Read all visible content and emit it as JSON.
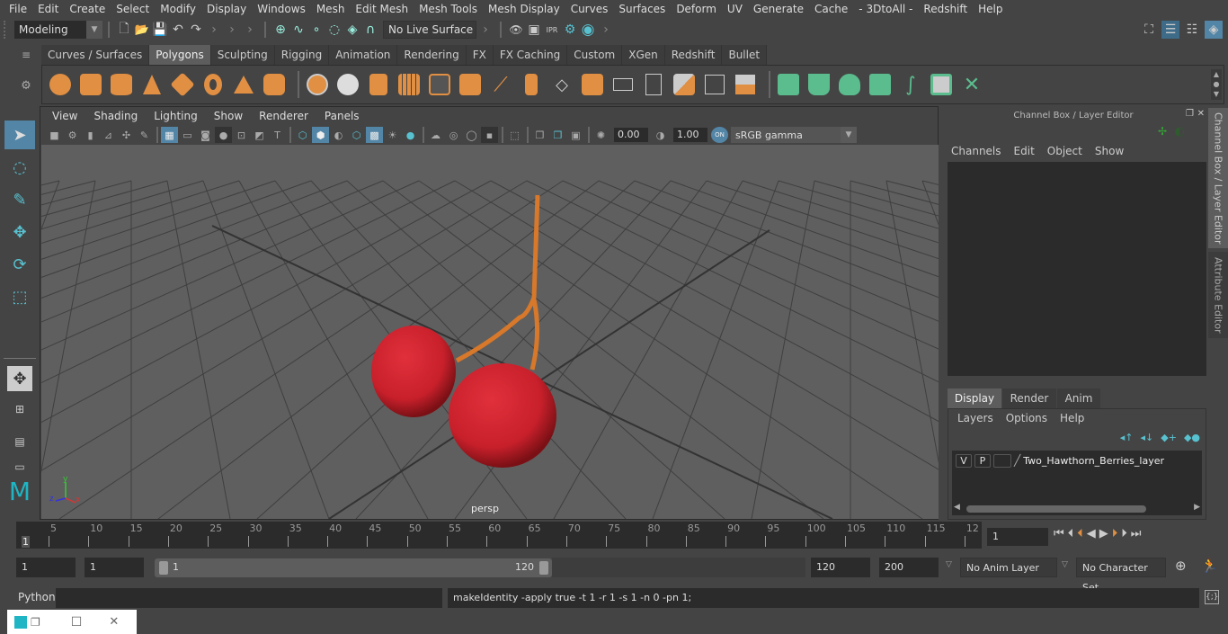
{
  "menubar": [
    "File",
    "Edit",
    "Create",
    "Select",
    "Modify",
    "Display",
    "Windows",
    "Mesh",
    "Edit Mesh",
    "Mesh Tools",
    "Mesh Display",
    "Curves",
    "Surfaces",
    "Deform",
    "UV",
    "Generate",
    "Cache",
    "- 3DtoAll -",
    "Redshift",
    "Help"
  ],
  "statusline": {
    "mode": "Modeling",
    "live_surface": "No Live Surface",
    "icons": [
      "new-scene-icon",
      "open-scene-icon",
      "save-scene-icon",
      "undo-icon",
      "redo-icon"
    ],
    "snap_icons": [
      "snap-grid-icon",
      "snap-curve-icon",
      "snap-point-icon",
      "snap-view-plane-icon",
      "snap-live-icon",
      "snap-magnet-icon"
    ],
    "render_icons": [
      "render-view-icon",
      "render-current-icon",
      "ipr-render-icon",
      "render-settings-icon",
      "hypershade-icon"
    ]
  },
  "shelf": {
    "tabs": [
      "Curves / Surfaces",
      "Polygons",
      "Sculpting",
      "Rigging",
      "Animation",
      "Rendering",
      "FX",
      "FX Caching",
      "Custom",
      "XGen",
      "Redshift",
      "Bullet"
    ],
    "active_tab": "Polygons",
    "poly_icons": [
      "poly-sphere-icon",
      "poly-cube-icon",
      "poly-cylinder-icon",
      "poly-cone-icon",
      "poly-plane-icon",
      "poly-torus-icon",
      "poly-pyramid-icon",
      "poly-pipe-icon"
    ],
    "edit_icons": [
      "combine-icon",
      "separate-icon",
      "mirror-icon",
      "smooth-icon",
      "extrude-icon",
      "bevel-icon",
      "bridge-icon",
      "insert-edge-loop-icon",
      "multi-cut-icon",
      "target-weld-icon",
      "merge-icon",
      "fill-hole-icon",
      "quad-draw-icon",
      "append-icon",
      "poke-icon"
    ],
    "uv_icons": [
      "planar-uv-icon",
      "cylindrical-uv-icon",
      "spherical-uv-icon",
      "auto-uv-icon",
      "unfold-uv-icon",
      "uv-editor-icon",
      "uv-layout-icon"
    ]
  },
  "viewport": {
    "menu": [
      "View",
      "Shading",
      "Lighting",
      "Show",
      "Renderer",
      "Panels"
    ],
    "exposure": "0.00",
    "gamma": "1.00",
    "color_mgmt": "ON",
    "color_space": "sRGB gamma",
    "camera_label": "persp",
    "axis": {
      "x": "x",
      "y": "y",
      "z": "z"
    }
  },
  "channel_box": {
    "title": "Channel Box / Layer Editor",
    "menu": [
      "Channels",
      "Edit",
      "Object",
      "Show"
    ]
  },
  "layer_editor": {
    "tabs": [
      "Display",
      "Render",
      "Anim"
    ],
    "active_tab": "Display",
    "menu": [
      "Layers",
      "Options",
      "Help"
    ],
    "layers": [
      {
        "v": "V",
        "p": "P",
        "name": "Two_Hawthorn_Berries_layer"
      }
    ]
  },
  "side_tabs": [
    "Channel Box / Layer Editor",
    "Attribute Editor"
  ],
  "timeline": {
    "ticks": [
      "5",
      "10",
      "15",
      "20",
      "25",
      "30",
      "35",
      "40",
      "45",
      "50",
      "55",
      "60",
      "65",
      "70",
      "75",
      "80",
      "85",
      "90",
      "95",
      "100",
      "105",
      "110",
      "115",
      "12"
    ],
    "current_marker": "1",
    "current_frame": "1"
  },
  "range": {
    "start": "1",
    "playback_start": "1",
    "slider_start": "1",
    "slider_end": "120",
    "playback_end": "120",
    "end": "200",
    "anim_layer": "No Anim Layer",
    "character_set": "No Character Set"
  },
  "command": {
    "label": "Python",
    "input": "",
    "result": "makeIdentity -apply true -t 1 -r 1 -s 1 -n 0 -pn 1;"
  },
  "taskbar_popup": {
    "restore": "❐",
    "maximize": "☐",
    "close": "✕"
  }
}
